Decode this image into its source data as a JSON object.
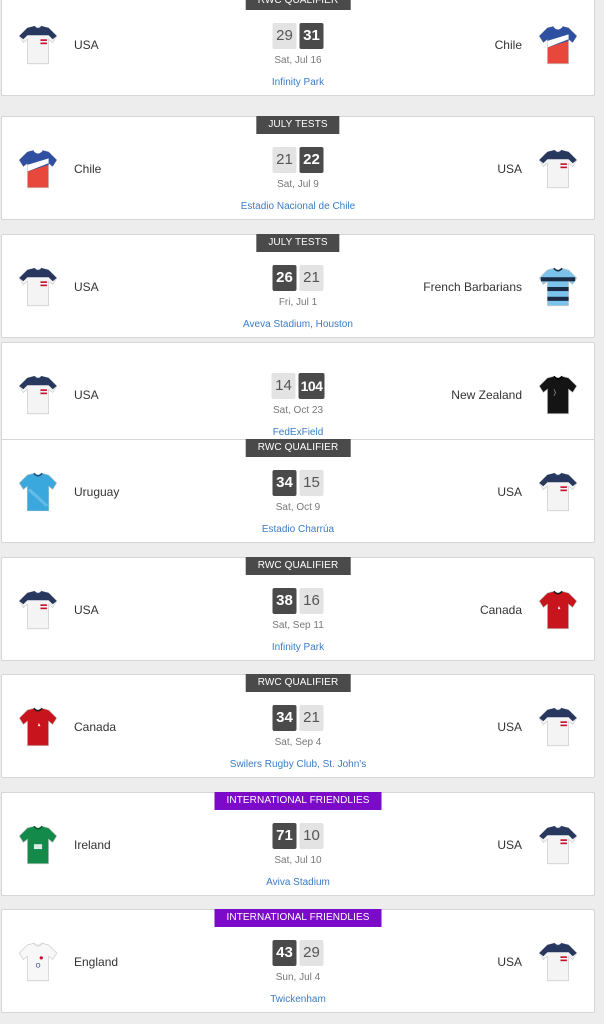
{
  "colors": {
    "competition_grey": "#4a4a4a",
    "competition_purple": "#7b0bc9",
    "venue_link": "#3b7cc6",
    "winning_score_bg": "#4a4a4a",
    "losing_score_bg": "#e3e3e3"
  },
  "jerseys": {
    "usa": "usa-jersey-icon",
    "chile": "chile-jersey-icon",
    "french-barbarians": "french-barbarians-jersey-icon",
    "new-zealand": "new-zealand-jersey-icon",
    "uruguay": "uruguay-jersey-icon",
    "canada": "canada-jersey-icon",
    "ireland": "ireland-jersey-icon",
    "england": "england-jersey-icon"
  },
  "matches": [
    {
      "competition": "RWC QUALIFIER",
      "style": "grey",
      "home": "USA",
      "home_kit": "usa",
      "home_score": "29",
      "away": "Chile",
      "away_kit": "chile",
      "away_score": "31",
      "winner": "away",
      "date": "Sat, Jul 16",
      "venue": "Infinity Park"
    },
    {
      "competition": "JULY TESTS",
      "style": "grey",
      "home": "Chile",
      "home_kit": "chile",
      "home_score": "21",
      "away": "USA",
      "away_kit": "usa",
      "away_score": "22",
      "winner": "away",
      "date": "Sat, Jul 9",
      "venue": "Estadio Nacional de Chile"
    },
    {
      "competition": "JULY TESTS",
      "style": "grey",
      "home": "USA",
      "home_kit": "usa",
      "home_score": "26",
      "away": "French Barbarians",
      "away_kit": "french-barbarians",
      "away_score": "21",
      "winner": "home",
      "date": "Fri, Jul 1",
      "venue": "Aveva Stadium, Houston"
    },
    {
      "competition": "",
      "style": "none",
      "home": "USA",
      "home_kit": "usa",
      "home_score": "14",
      "away": "New Zealand",
      "away_kit": "new-zealand",
      "away_score": "104",
      "winner": "away",
      "date": "Sat, Oct 23",
      "venue": "FedExField"
    },
    {
      "competition": "RWC QUALIFIER",
      "style": "grey",
      "home": "Uruguay",
      "home_kit": "uruguay",
      "home_score": "34",
      "away": "USA",
      "away_kit": "usa",
      "away_score": "15",
      "winner": "home",
      "date": "Sat, Oct 9",
      "venue": "Estadio Charrúa"
    },
    {
      "competition": "RWC QUALIFIER",
      "style": "grey",
      "home": "USA",
      "home_kit": "usa",
      "home_score": "38",
      "away": "Canada",
      "away_kit": "canada",
      "away_score": "16",
      "winner": "home",
      "date": "Sat, Sep 11",
      "venue": "Infinity Park"
    },
    {
      "competition": "RWC QUALIFIER",
      "style": "grey",
      "home": "Canada",
      "home_kit": "canada",
      "home_score": "34",
      "away": "USA",
      "away_kit": "usa",
      "away_score": "21",
      "winner": "home",
      "date": "Sat, Sep 4",
      "venue": "Swilers Rugby Club, St. John's"
    },
    {
      "competition": "INTERNATIONAL FRIENDLIES",
      "style": "purple",
      "home": "Ireland",
      "home_kit": "ireland",
      "home_score": "71",
      "away": "USA",
      "away_kit": "usa",
      "away_score": "10",
      "winner": "home",
      "date": "Sat, Jul 10",
      "venue": "Aviva Stadium"
    },
    {
      "competition": "INTERNATIONAL FRIENDLIES",
      "style": "purple",
      "home": "England",
      "home_kit": "england",
      "home_score": "43",
      "away": "USA",
      "away_kit": "usa",
      "away_score": "29",
      "winner": "home",
      "date": "Sun, Jul 4",
      "venue": "Twickenham"
    }
  ]
}
